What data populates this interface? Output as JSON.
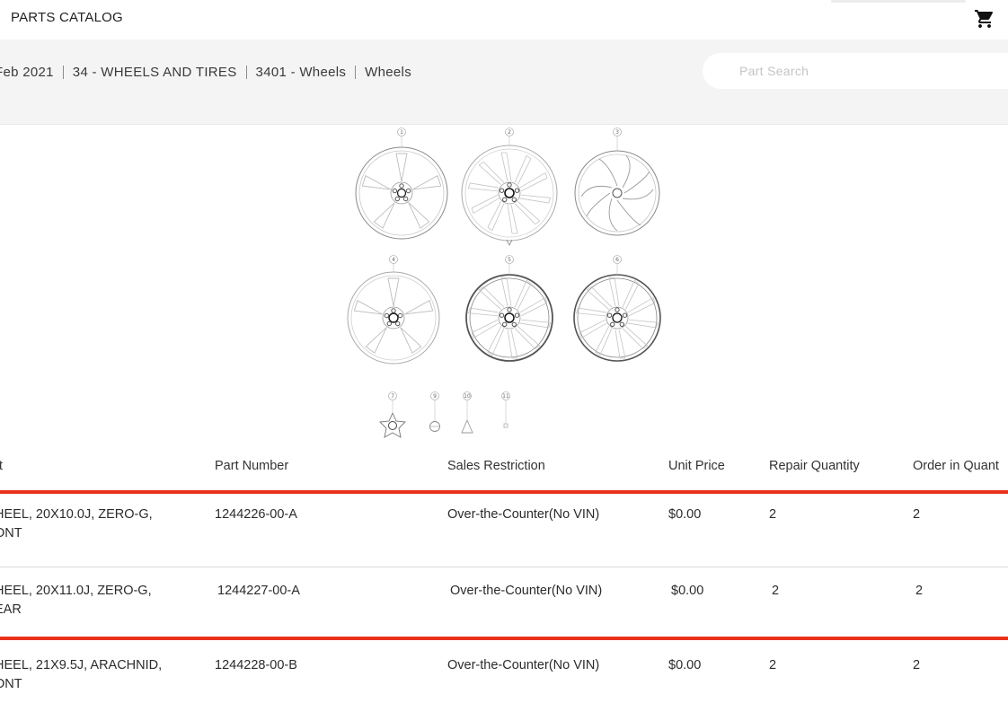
{
  "header": {
    "app_title": "PARTS CATALOG",
    "cart_icon": "shopping-cart-icon"
  },
  "breadcrumb": [
    "Feb 2021",
    "34 - WHEELS AND TIRES",
    "3401 - Wheels",
    "Wheels"
  ],
  "search": {
    "placeholder": "Part Search",
    "value": ""
  },
  "diagram": {
    "callouts": [
      "1",
      "2",
      "3",
      "4",
      "5",
      "6",
      "7",
      "9",
      "10",
      "11"
    ]
  },
  "table": {
    "headers": [
      "rt",
      "Part Number",
      "Sales Restriction",
      "Unit Price",
      "Repair Quantity",
      "Order in Quant"
    ],
    "rows": [
      {
        "part_line1": "HEEL, 20X10.0J, ZERO-G,",
        "part_line2": "ONT",
        "part_number": "1244226-00-A",
        "sales_restriction": "Over-the-Counter(No VIN)",
        "unit_price": "$0.00",
        "repair_quantity": "2",
        "order_quantity": "2"
      },
      {
        "part_line1": "HEEL, 20X11.0J, ZERO-G,",
        "part_line2": "EAR",
        "part_number": "1244227-00-A",
        "sales_restriction": "Over-the-Counter(No VIN)",
        "unit_price": "$0.00",
        "repair_quantity": "2",
        "order_quantity": "2"
      },
      {
        "part_line1": "HEEL, 21X9.5J, ARACHNID,",
        "part_line2": "ONT",
        "part_number": "1244228-00-B",
        "sales_restriction": "Over-the-Counter(No VIN)",
        "unit_price": "$0.00",
        "repair_quantity": "2",
        "order_quantity": "2"
      }
    ]
  },
  "colors": {
    "highlight": "#e8321c",
    "band": "#f4f4f4"
  }
}
